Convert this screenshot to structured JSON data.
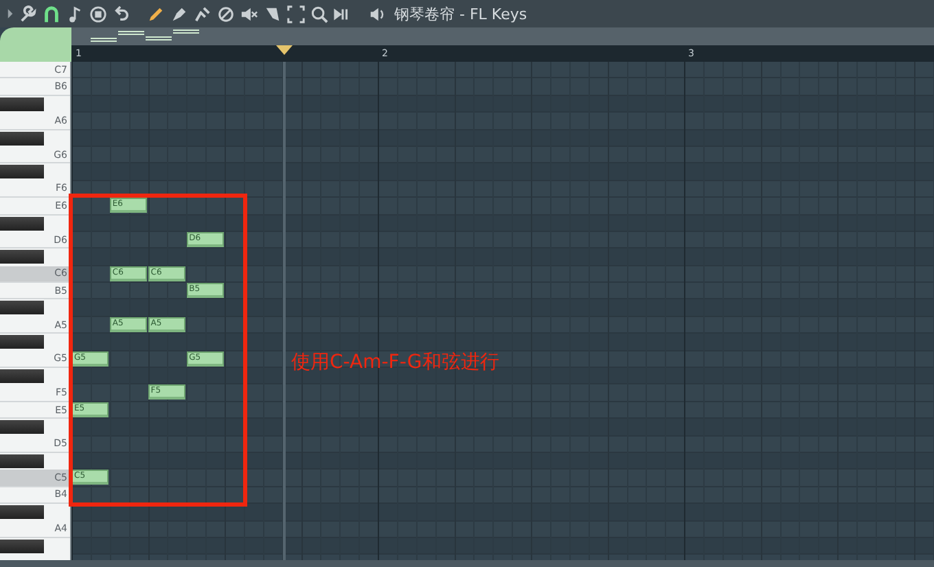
{
  "window": {
    "title": "钢琴卷帘 - FL Keys"
  },
  "ruler": {
    "bars": [
      "1",
      "2",
      "3"
    ]
  },
  "rows": [
    {
      "kind": "white",
      "label": "C7",
      "slots": []
    },
    {
      "kind": "white",
      "label": "B6",
      "slots": []
    },
    {
      "kind": "black",
      "slots": []
    },
    {
      "kind": "white",
      "label": "A6",
      "slots": []
    },
    {
      "kind": "black",
      "slots": []
    },
    {
      "kind": "white",
      "label": "G6",
      "slots": []
    },
    {
      "kind": "black",
      "slots": []
    },
    {
      "kind": "white",
      "label": "F6",
      "slots": []
    },
    {
      "kind": "white",
      "label": "E6",
      "slots": [
        {
          "kind": "empty"
        },
        {
          "kind": "note",
          "label": "E6"
        }
      ]
    },
    {
      "kind": "black",
      "slots": []
    },
    {
      "kind": "white",
      "label": "D6",
      "slots": [
        {
          "kind": "empty"
        },
        {
          "kind": "empty"
        },
        {
          "kind": "empty"
        },
        {
          "kind": "note",
          "label": "D6"
        }
      ]
    },
    {
      "kind": "black",
      "slots": []
    },
    {
      "kind": "c",
      "label": "C6",
      "slots": [
        {
          "kind": "empty"
        },
        {
          "kind": "note",
          "label": "C6"
        },
        {
          "kind": "note",
          "label": "C6"
        }
      ]
    },
    {
      "kind": "white",
      "label": "B5",
      "slots": [
        {
          "kind": "empty"
        },
        {
          "kind": "empty"
        },
        {
          "kind": "empty"
        },
        {
          "kind": "note",
          "label": "B5"
        }
      ]
    },
    {
      "kind": "black",
      "slots": []
    },
    {
      "kind": "white",
      "label": "A5",
      "slots": [
        {
          "kind": "empty"
        },
        {
          "kind": "note",
          "label": "A5"
        },
        {
          "kind": "note",
          "label": "A5"
        }
      ]
    },
    {
      "kind": "black",
      "slots": []
    },
    {
      "kind": "white",
      "label": "G5",
      "slots": [
        {
          "kind": "note",
          "label": "G5"
        },
        {
          "kind": "empty"
        },
        {
          "kind": "empty"
        },
        {
          "kind": "note",
          "label": "G5"
        }
      ]
    },
    {
      "kind": "black",
      "slots": []
    },
    {
      "kind": "white",
      "label": "F5",
      "slots": [
        {
          "kind": "empty"
        },
        {
          "kind": "empty"
        },
        {
          "kind": "note",
          "label": "F5"
        }
      ]
    },
    {
      "kind": "white",
      "label": "E5",
      "slots": [
        {
          "kind": "note",
          "label": "E5"
        }
      ]
    },
    {
      "kind": "black",
      "slots": []
    },
    {
      "kind": "white",
      "label": "D5",
      "slots": []
    },
    {
      "kind": "black",
      "slots": []
    },
    {
      "kind": "c",
      "label": "C5",
      "slots": [
        {
          "kind": "note",
          "label": "C5"
        }
      ]
    },
    {
      "kind": "white",
      "label": "B4",
      "slots": []
    },
    {
      "kind": "black",
      "slots": []
    },
    {
      "kind": "white",
      "label": "A4",
      "slots": []
    },
    {
      "kind": "black",
      "slots": []
    }
  ],
  "annotation": {
    "text": "使用C-Am-F-G和弦进行"
  }
}
